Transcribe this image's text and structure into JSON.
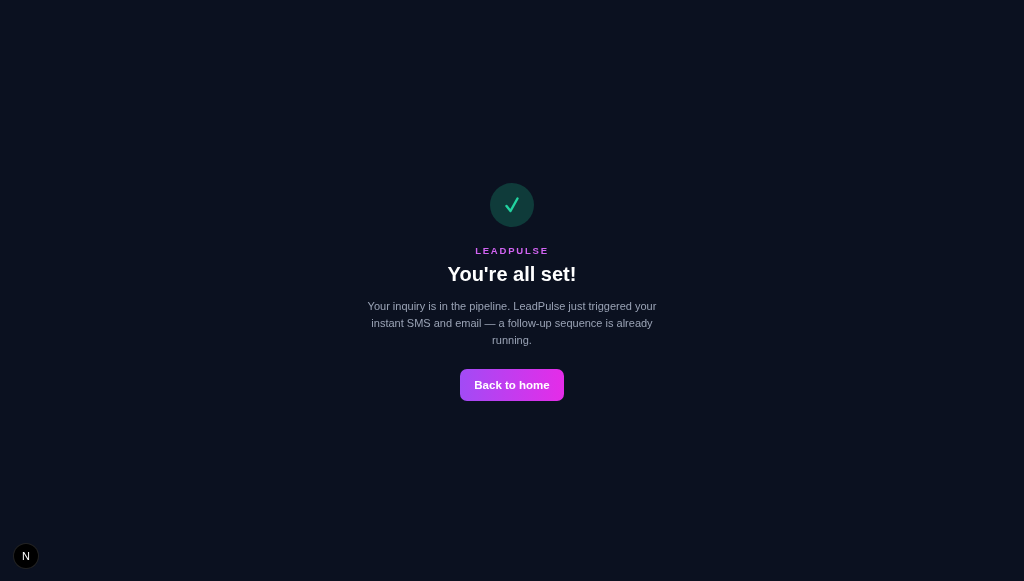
{
  "brand": "LEADPULSE",
  "heading": "You're all set!",
  "message": "Your inquiry is in the pipeline. LeadPulse just triggered your instant SMS and email — a follow-up sequence is already running.",
  "button": "Back to home",
  "dev_badge": "N"
}
